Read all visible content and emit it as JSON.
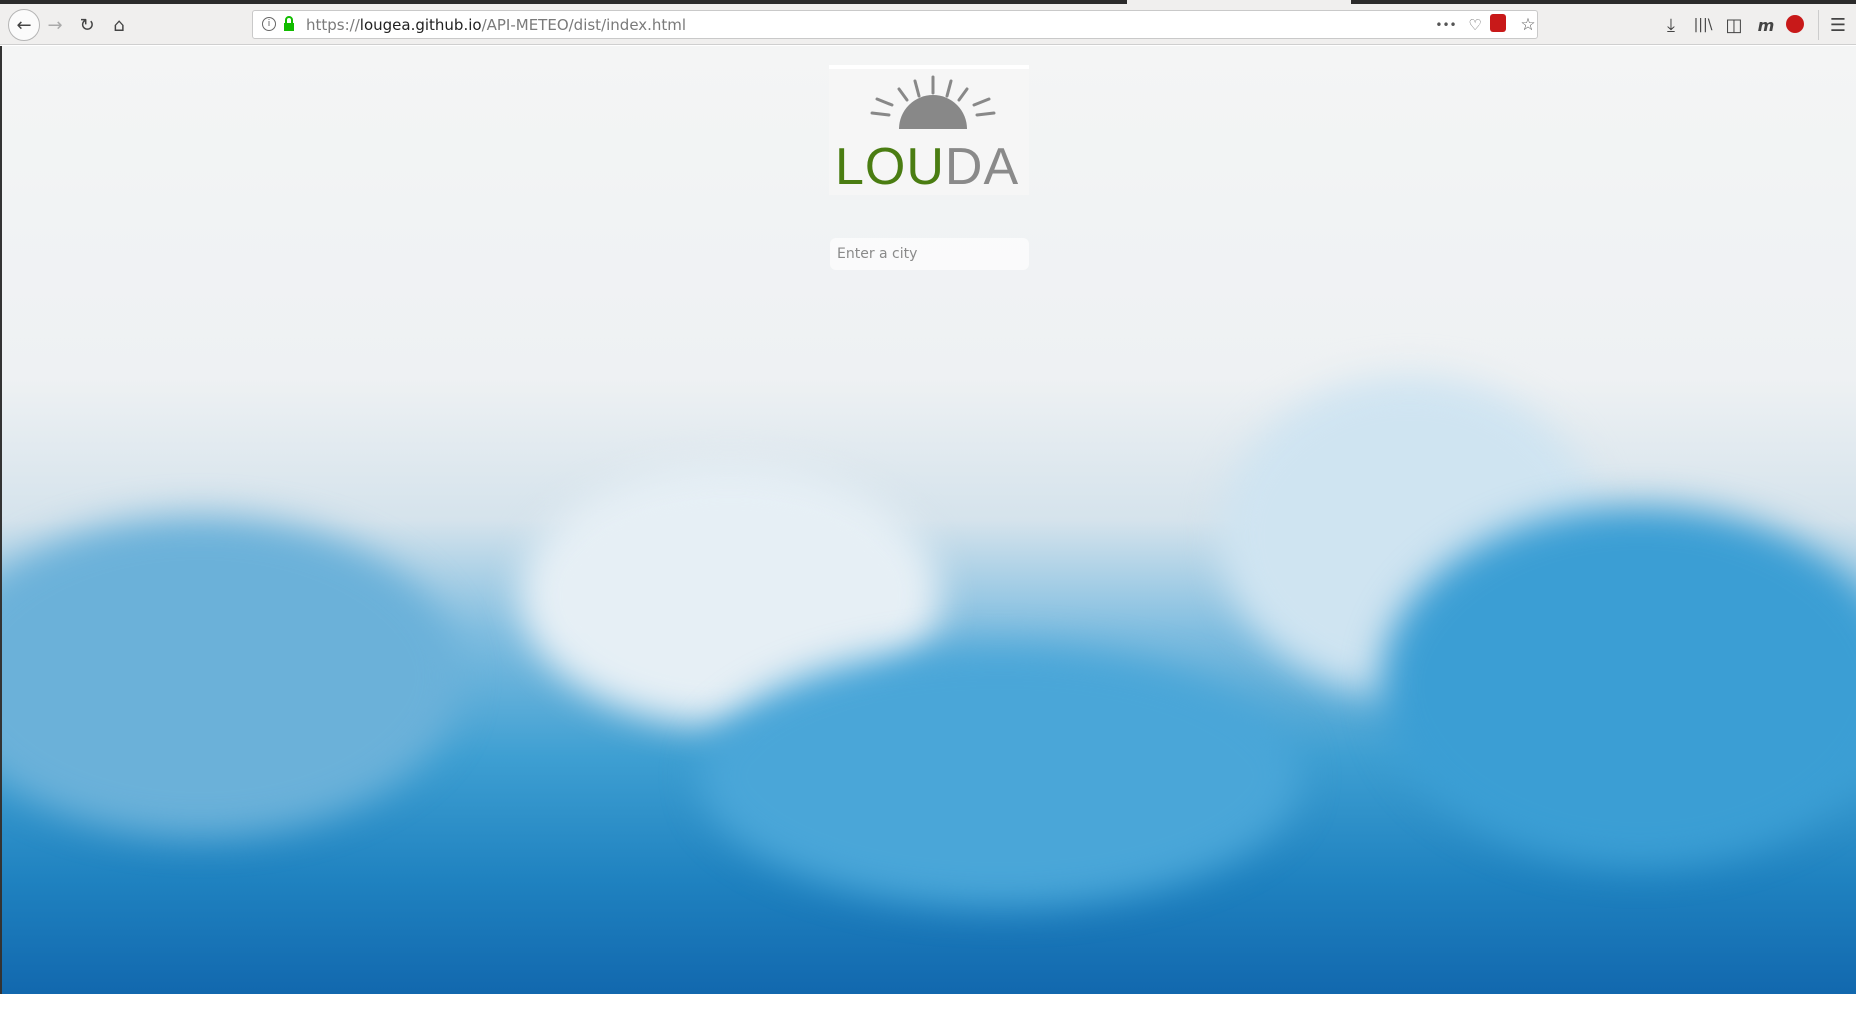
{
  "browser": {
    "url_scheme": "https://",
    "url_domain": "lougea.github.io",
    "url_path": "/API-METEO/dist/index.html",
    "page_actions_icon": "•••",
    "menu_icon": "☰"
  },
  "logo": {
    "text_green": "LOU",
    "text_gray": "DA",
    "colors": {
      "green": "#4a7d12",
      "gray": "#8a8a8a"
    }
  },
  "search": {
    "placeholder": "Enter a city",
    "value": ""
  }
}
